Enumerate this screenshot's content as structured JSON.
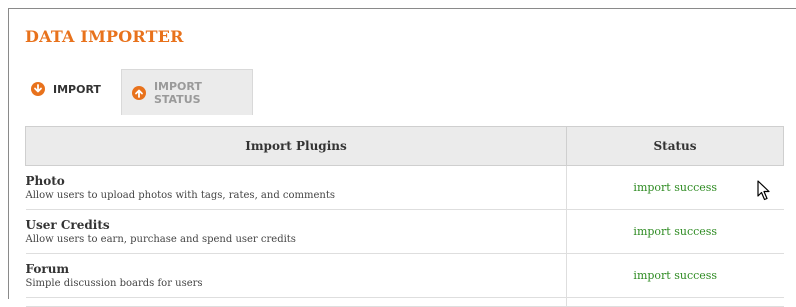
{
  "page": {
    "title": "DATA IMPORTER"
  },
  "tabs": [
    {
      "label": "IMPORT",
      "icon": "arrow-down-circle-icon",
      "active": false
    },
    {
      "label": "IMPORT STATUS",
      "icon": "arrow-up-circle-icon",
      "active": true
    }
  ],
  "colors": {
    "accent": "#e8721c",
    "success": "#2e8b22",
    "header_bg": "#ebebeb"
  },
  "table": {
    "headers": {
      "plugin": "Import Plugins",
      "status": "Status"
    },
    "rows": [
      {
        "name": "Photo",
        "description": "Allow users to upload photos with tags, rates, and comments",
        "status": "import success"
      },
      {
        "name": "User Credits",
        "description": "Allow users to earn, purchase and spend user credits",
        "status": "import success"
      },
      {
        "name": "Forum",
        "description": "Simple discussion boards for users",
        "status": "import success"
      }
    ]
  }
}
